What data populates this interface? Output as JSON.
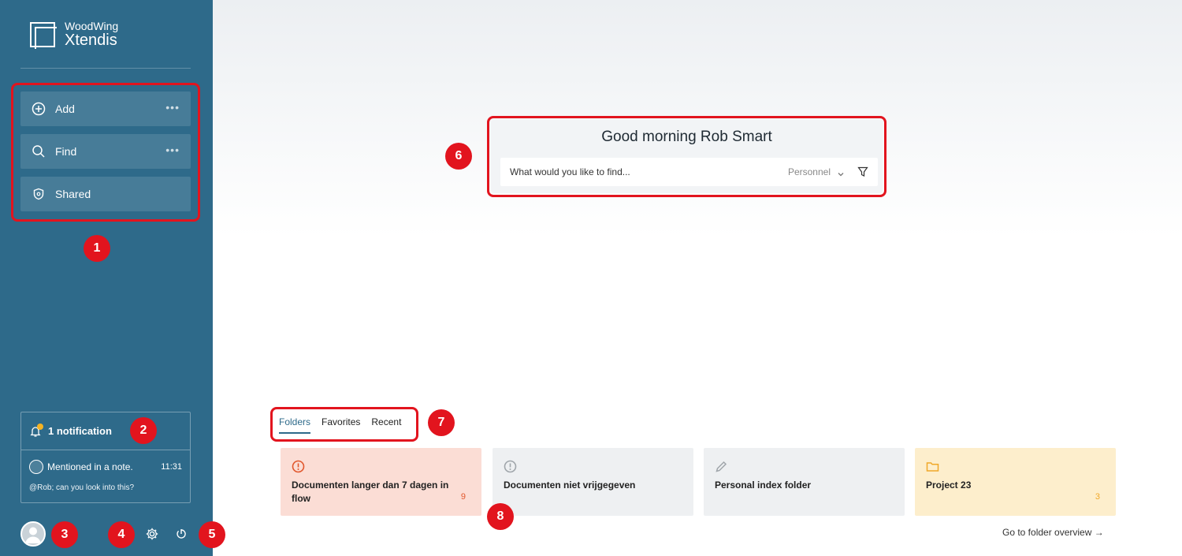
{
  "app": {
    "brand_top": "WoodWing",
    "brand_bottom": "Xtendis"
  },
  "sidebar": {
    "nav": [
      {
        "label": "Add",
        "icon": "plus-circle-icon",
        "more": "•••"
      },
      {
        "label": "Find",
        "icon": "search-icon",
        "more": "•••"
      },
      {
        "label": "Shared",
        "icon": "shield-icon"
      }
    ],
    "notifications": {
      "title": "1 notification",
      "item": {
        "title": "Mentioned in a note.",
        "time": "11:31",
        "text": "@Rob; can you look into this?"
      }
    }
  },
  "main": {
    "greeting": "Good morning Rob Smart",
    "search": {
      "placeholder": "What would you like to find...",
      "scope": "Personnel"
    },
    "tabs": [
      {
        "label": "Folders",
        "active": true
      },
      {
        "label": "Favorites",
        "active": false
      },
      {
        "label": "Recent",
        "active": false
      }
    ],
    "folders": [
      {
        "name": "Documenten langer dan 7 dagen in flow",
        "count": "9",
        "icon": "alert-circle-icon",
        "bg": "#fbddd5",
        "accent": "#e1572d"
      },
      {
        "name": "Documenten niet vrijgegeven",
        "count": "",
        "icon": "info-circle-icon",
        "bg": "#eef0f2",
        "accent": "#a0a6ab"
      },
      {
        "name": "Personal index folder",
        "count": "",
        "icon": "pencil-icon",
        "bg": "#eef0f2",
        "accent": "#a0a6ab"
      },
      {
        "name": "Project 23",
        "count": "3",
        "icon": "folder-icon",
        "bg": "#fdeecc",
        "accent": "#f0a829"
      }
    ],
    "folder_link": "Go to folder overview →"
  },
  "annotations": [
    "1",
    "2",
    "3",
    "4",
    "5",
    "6",
    "7",
    "8"
  ],
  "colors": {
    "sidebar": "#2e6a8a",
    "highlight": "#e2141e",
    "notification_dot": "#f5b323"
  }
}
